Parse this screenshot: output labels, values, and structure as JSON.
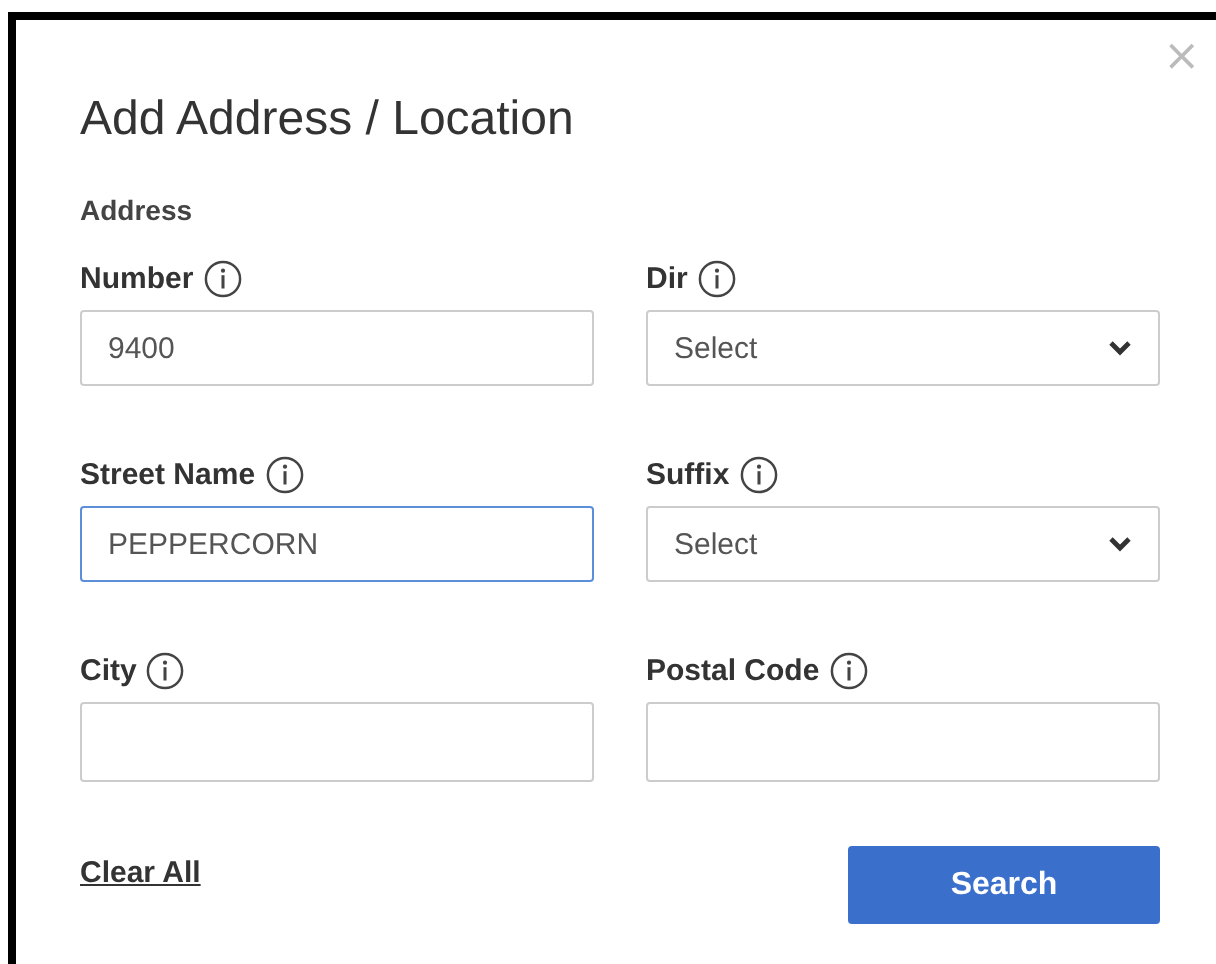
{
  "dialog": {
    "title": "Add Address / Location",
    "close": "×"
  },
  "section": "Address",
  "fields": [
    {
      "kind": "text",
      "label": "Number",
      "value": "9400",
      "focused": false
    },
    {
      "kind": "select",
      "label": "Dir",
      "value": "Select",
      "focused": false
    },
    {
      "kind": "text",
      "label": "Street Name",
      "value": "PEPPERCORN",
      "focused": true
    },
    {
      "kind": "select",
      "label": "Suffix",
      "value": "Select",
      "focused": false
    },
    {
      "kind": "text",
      "label": "City",
      "focused": false
    },
    {
      "kind": "text",
      "label": "Postal Code",
      "focused": false
    }
  ],
  "actions": {
    "clear": "Clear All",
    "search": "Search"
  }
}
